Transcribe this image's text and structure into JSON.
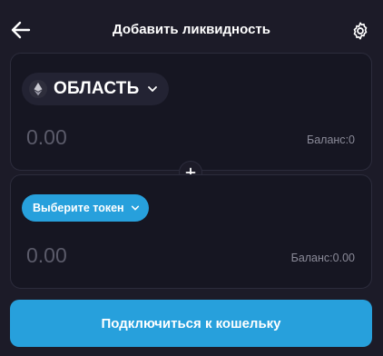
{
  "header": {
    "title": "Добавить ликвидность",
    "back_icon": "arrow-left-icon",
    "settings_icon": "gear-icon"
  },
  "input_a": {
    "token_icon": "ethereum-icon",
    "token_label": "ОБЛАСТЬ",
    "amount_placeholder": "0.00",
    "balance_label": "Баланс",
    "balance_value": "0"
  },
  "input_b": {
    "select_label": "Выберите токен",
    "amount_placeholder": "0.00",
    "balance_label": "Баланс",
    "balance_value": "0.00"
  },
  "add_icon": "plus-icon",
  "connect_label": "Подключиться к кошельку",
  "colors": {
    "background": "#1c1b28",
    "panel": "#161622",
    "accent": "#27a0dc",
    "muted_text": "#8a8a98",
    "placeholder_text": "#5b5b6a"
  }
}
